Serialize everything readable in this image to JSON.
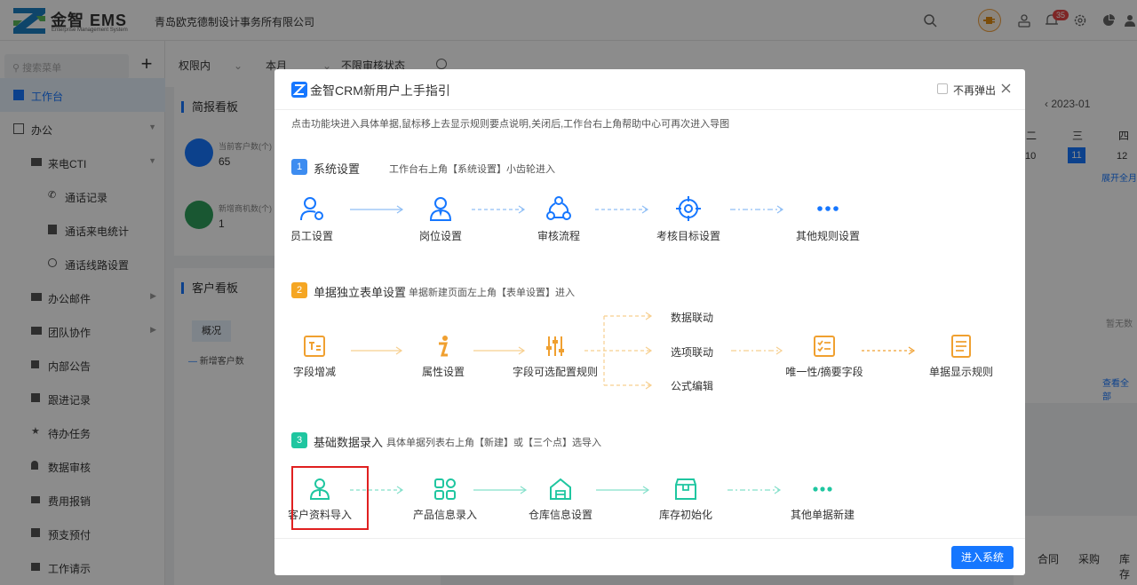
{
  "app": {
    "logo_text": "金智 EMS",
    "logo_subtitle": "Enterprise Management System",
    "company_name": "青岛欧克德制设计事务所有限公司",
    "notification_count": "35"
  },
  "sidebar": {
    "search_placeholder": "搜索菜单",
    "add_label": "+",
    "items": [
      {
        "label": "工作台",
        "icon": "dashboard-icon",
        "active": true
      },
      {
        "label": "办公",
        "icon": "office-icon"
      },
      {
        "label": "来电CTI",
        "icon": "folder-icon"
      },
      {
        "label": "通话记录",
        "icon": "phone-icon"
      },
      {
        "label": "通话来电统计",
        "icon": "stats-icon"
      },
      {
        "label": "通话线路设置",
        "icon": "gear-icon"
      },
      {
        "label": "办公邮件",
        "icon": "folder-icon"
      },
      {
        "label": "团队协作",
        "icon": "folder-icon"
      },
      {
        "label": "内部公告",
        "icon": "announce-icon"
      },
      {
        "label": "跟进记录",
        "icon": "note-icon"
      },
      {
        "label": "待办任务",
        "icon": "task-icon"
      },
      {
        "label": "数据审核",
        "icon": "user-icon"
      },
      {
        "label": "费用报销",
        "icon": "expense-icon"
      },
      {
        "label": "预支预付",
        "icon": "prepay-icon"
      },
      {
        "label": "工作请示",
        "icon": "request-icon"
      }
    ]
  },
  "filters": {
    "scope": "权限内",
    "period": "本月",
    "audit_status": "不限审核状态"
  },
  "dashboard": {
    "brief_title": "简报看板",
    "stat1_label": "当前客户数(个)",
    "stat1_value": "65",
    "stat2_label": "新增商机数(个)",
    "stat2_value": "1",
    "customer_title": "客户看板",
    "tab_overview": "概况",
    "legend_new_customers": "新增客户数",
    "calendar_month": "2023-01",
    "calendar_days": [
      "二",
      "三",
      "四"
    ],
    "calendar_dates": [
      "10",
      "11",
      "12"
    ],
    "expand_all": "展开全月",
    "no_data": "暂无数",
    "view_all": "查看全部",
    "bottom_tabs": [
      "合同",
      "采购",
      "库存"
    ]
  },
  "modal": {
    "title": "金智CRM新用户上手指引",
    "no_popup_label": "不再弹出",
    "description": "点击功能块进入具体单据,鼠标移上去显示规则要点说明,关闭后,工作台右上角帮助中心可再次进入导图",
    "sections": [
      {
        "num": "1",
        "title": "系统设置",
        "subtitle": "工作台右上角【系统设置】小齿轮进入",
        "nodes": [
          "员工设置",
          "岗位设置",
          "审核流程",
          "考核目标设置",
          "其他规则设置"
        ]
      },
      {
        "num": "2",
        "title": "单据独立表单设置",
        "subtitle": "单据新建页面左上角【表单设置】进入",
        "nodes": [
          "字段增减",
          "属性设置",
          "字段可选配置规则",
          "唯一性/摘要字段",
          "单据显示规则"
        ],
        "branches": [
          "数据联动",
          "选项联动",
          "公式编辑"
        ]
      },
      {
        "num": "3",
        "title": "基础数据录入",
        "subtitle": "具体单据列表右上角【新建】或【三个点】选导入",
        "nodes": [
          "客户资料导入",
          "产品信息录入",
          "仓库信息设置",
          "库存初始化",
          "其他单据新建"
        ]
      }
    ],
    "enter_button": "进入系统"
  }
}
